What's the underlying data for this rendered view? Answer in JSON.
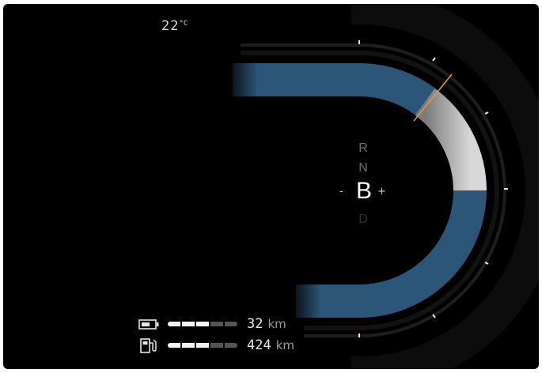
{
  "status": {
    "temperature": "22",
    "temperature_unit": "°C"
  },
  "gear_selector": {
    "gears": [
      "R",
      "N",
      "B",
      "D"
    ],
    "selected": "B",
    "minus": "-",
    "plus": "+"
  },
  "power_meter": {
    "type": "arc-gauge",
    "colors": {
      "charge_band": "#2c5678",
      "power_band": "#cfcfcf",
      "needle": "#e0a030"
    }
  },
  "ranges": [
    {
      "icon": "battery-icon",
      "value": "32",
      "unit": "km",
      "segments_total": 5,
      "segments_filled": 3
    },
    {
      "icon": "fuel-pump-icon",
      "value": "424",
      "unit": "km",
      "segments_total": 5,
      "segments_filled": 3
    }
  ]
}
